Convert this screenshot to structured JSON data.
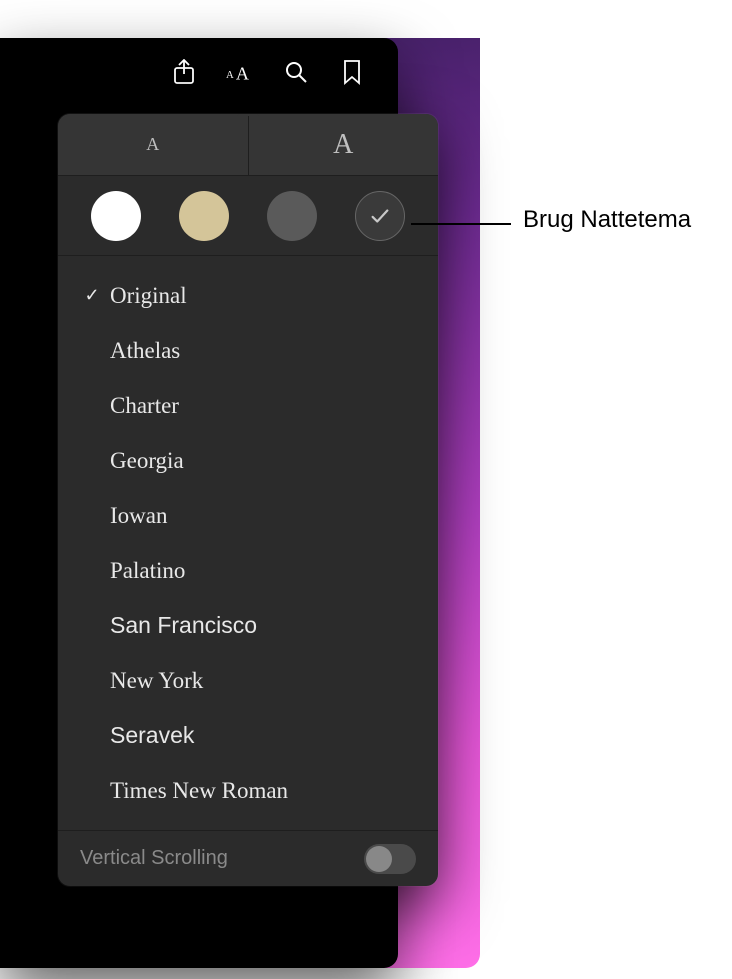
{
  "toolbar": {
    "share_icon": "share-icon",
    "appearance_icon": "text-size-icon",
    "search_icon": "search-icon",
    "bookmark_icon": "bookmark-icon"
  },
  "size": {
    "small_label": "A",
    "large_label": "A"
  },
  "themes": {
    "white": "#ffffff",
    "sepia": "#d4c599",
    "gray": "#5a5a5a",
    "night": "#3a3a3a",
    "night_check": "✓"
  },
  "fonts": [
    {
      "name": "Original",
      "selected": true
    },
    {
      "name": "Athelas",
      "selected": false
    },
    {
      "name": "Charter",
      "selected": false
    },
    {
      "name": "Georgia",
      "selected": false
    },
    {
      "name": "Iowan",
      "selected": false
    },
    {
      "name": "Palatino",
      "selected": false
    },
    {
      "name": "San Francisco",
      "selected": false
    },
    {
      "name": "New York",
      "selected": false
    },
    {
      "name": "Seravek",
      "selected": false
    },
    {
      "name": "Times New Roman",
      "selected": false
    }
  ],
  "scrolling": {
    "label": "Vertical Scrolling",
    "enabled": false
  },
  "callout": {
    "label": "Brug Nattetema"
  },
  "check_mark": "✓"
}
